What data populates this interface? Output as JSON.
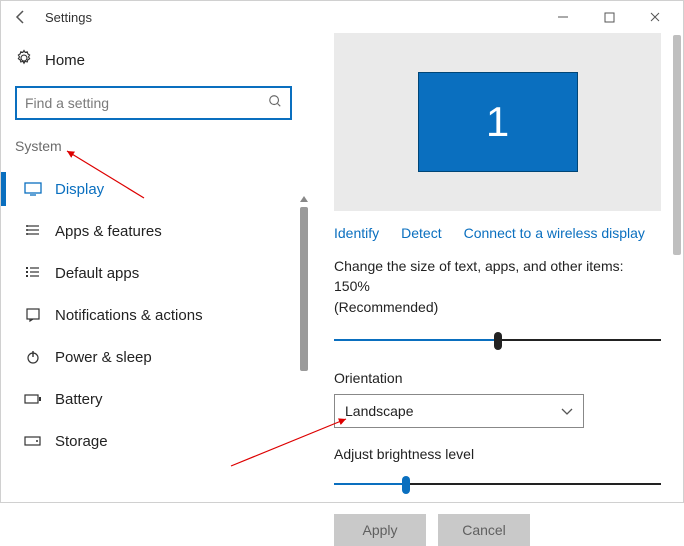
{
  "window": {
    "title": "Settings"
  },
  "sidebar": {
    "home_label": "Home",
    "search_placeholder": "Find a setting",
    "section": "System",
    "items": [
      {
        "icon": "display",
        "label": "Display",
        "active": true
      },
      {
        "icon": "apps",
        "label": "Apps & features",
        "active": false
      },
      {
        "icon": "defaults",
        "label": "Default apps",
        "active": false
      },
      {
        "icon": "notifications",
        "label": "Notifications & actions",
        "active": false
      },
      {
        "icon": "power",
        "label": "Power & sleep",
        "active": false
      },
      {
        "icon": "battery",
        "label": "Battery",
        "active": false
      },
      {
        "icon": "storage",
        "label": "Storage",
        "active": false
      }
    ]
  },
  "main": {
    "monitor_number": "1",
    "links": {
      "identify": "Identify",
      "detect": "Detect",
      "connect": "Connect to a wireless display"
    },
    "scale_label_line1": "Change the size of text, apps, and other items: 150%",
    "scale_label_line2": "(Recommended)",
    "orientation_label": "Orientation",
    "orientation_value": "Landscape",
    "brightness_label": "Adjust brightness level",
    "buttons": {
      "apply": "Apply",
      "cancel": "Cancel"
    }
  }
}
